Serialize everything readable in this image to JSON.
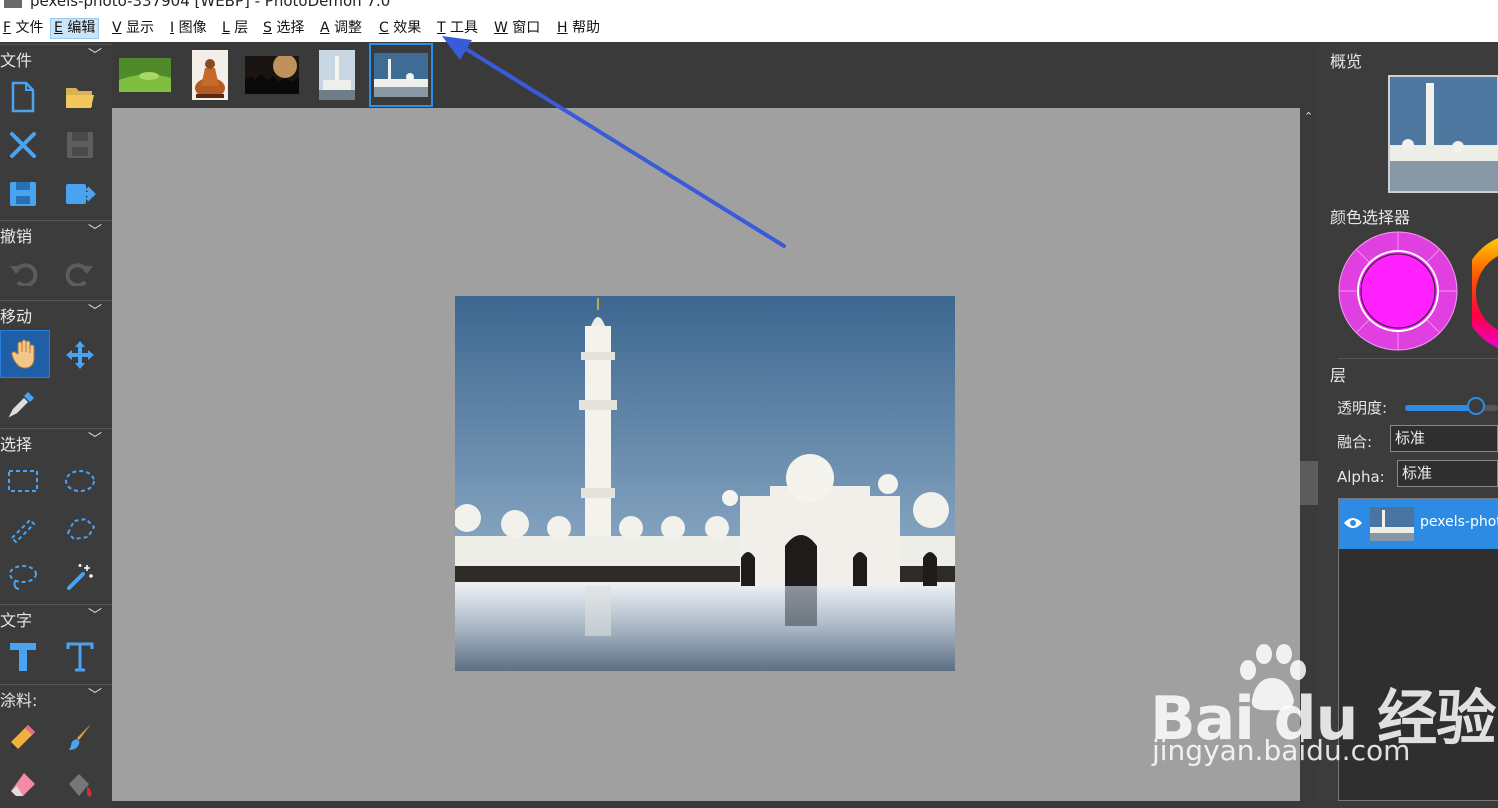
{
  "window": {
    "title": "pexels-photo-337904 [WEBP] - PhotoDemon 7.0"
  },
  "menu": [
    {
      "key": "F",
      "label": "文件"
    },
    {
      "key": "E",
      "label": "编辑"
    },
    {
      "key": "V",
      "label": "显示"
    },
    {
      "key": "I",
      "label": "图像"
    },
    {
      "key": "L",
      "label": "层"
    },
    {
      "key": "S",
      "label": "选择"
    },
    {
      "key": "A",
      "label": "调整"
    },
    {
      "key": "C",
      "label": "效果"
    },
    {
      "key": "T",
      "label": "工具"
    },
    {
      "key": "W",
      "label": "窗口"
    },
    {
      "key": "H",
      "label": "帮助"
    }
  ],
  "toolbox": {
    "sections": {
      "file": "文件",
      "undo": "撤销",
      "move": "移动",
      "select": "选择",
      "text": "文字",
      "paint": "涂料:"
    }
  },
  "right_panel": {
    "overview_title": "概览",
    "color_picker_title": "颜色选择器",
    "layers_title": "层",
    "opacity_label": "透明度:",
    "opacity_value": 0.95,
    "blend_label": "融合:",
    "blend_value": "标准",
    "alpha_label": "Alpha:",
    "alpha_value": "标准",
    "layer_name": "pexels-photo"
  },
  "colors": {
    "primary": "#ff22ff",
    "accent": "#2d8be3",
    "arrow": "#3a5bd9"
  },
  "watermark": {
    "brand": "Bai du 经验",
    "url": "jingyan.baidu.com"
  }
}
